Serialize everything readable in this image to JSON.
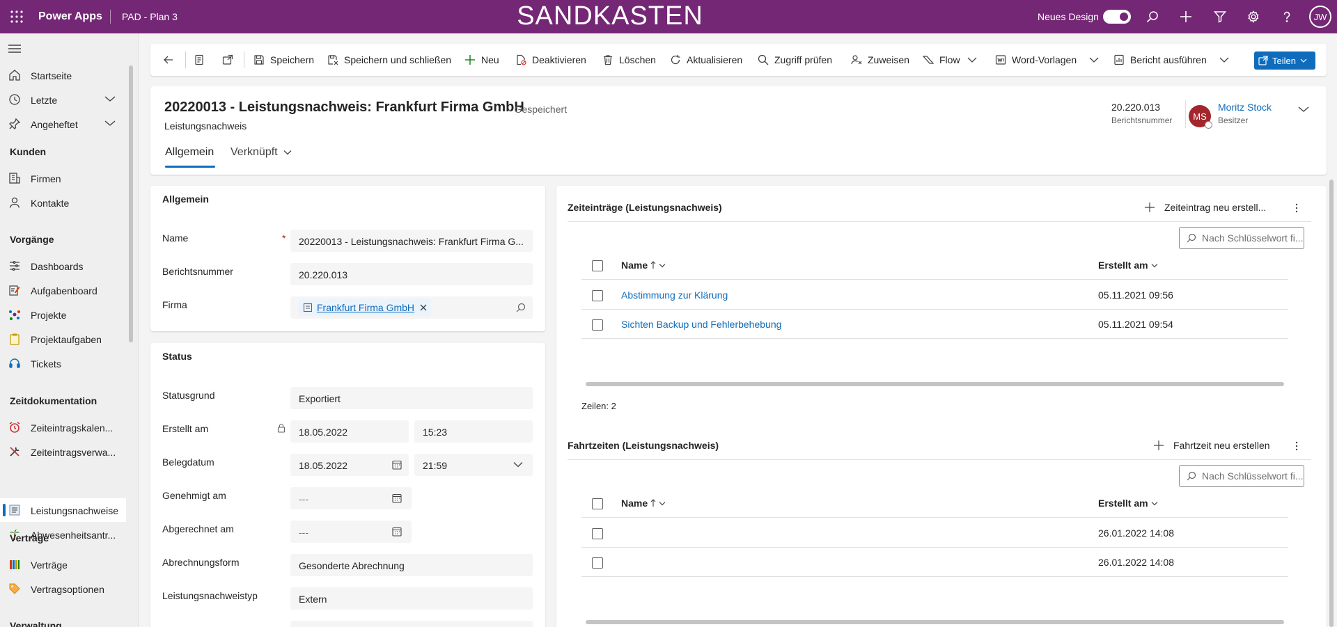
{
  "topbar": {
    "app_name": "Power Apps",
    "app_title": "PAD - Plan 3",
    "environment": "SANDKASTEN",
    "new_design_label": "Neues Design",
    "new_design_on": true,
    "user_initials": "JW",
    "icons": [
      "waffle-icon",
      "search-icon",
      "plus-icon",
      "filter-icon",
      "settings-icon",
      "help-icon"
    ]
  },
  "sidebar": {
    "items_top": [
      {
        "label": "Startseite",
        "icon": "home-icon"
      },
      {
        "label": "Letzte",
        "icon": "clock-icon",
        "expandable": true
      },
      {
        "label": "Angeheftet",
        "icon": "pin-icon",
        "expandable": true
      }
    ],
    "groups": [
      {
        "title": "Kunden",
        "items": [
          {
            "label": "Firmen",
            "icon": "building-icon"
          },
          {
            "label": "Kontakte",
            "icon": "person-icon"
          }
        ]
      },
      {
        "title": "Vorgänge",
        "items": [
          {
            "label": "Dashboards",
            "icon": "dashboard-icon"
          },
          {
            "label": "Aufgabenboard",
            "icon": "taskboard-icon"
          },
          {
            "label": "Projekte",
            "icon": "projects-icon"
          },
          {
            "label": "Projektaufgaben",
            "icon": "clipboard-icon"
          },
          {
            "label": "Tickets",
            "icon": "headset-icon"
          }
        ]
      },
      {
        "title": "Zeitdokumentation",
        "items": [
          {
            "label": "Zeiteintragskalen...",
            "icon": "alarm-icon"
          },
          {
            "label": "Zeiteintragsverwa...",
            "icon": "tools-icon"
          },
          {
            "label": "Leistungsnachweise",
            "icon": "report-icon",
            "active": true
          },
          {
            "label": "Abwesenheitsantr...",
            "icon": "palm-tree-icon"
          }
        ]
      },
      {
        "title": "Verträge",
        "items": [
          {
            "label": "Verträge",
            "icon": "books-icon"
          },
          {
            "label": "Vertragsoptionen",
            "icon": "tag-icon"
          }
        ]
      },
      {
        "title": "Verwaltung",
        "items": []
      }
    ]
  },
  "commandbar": {
    "items": [
      {
        "label": "Speichern",
        "icon": "save-icon"
      },
      {
        "label": "Speichern und schließen",
        "icon": "save-close-icon"
      },
      {
        "label": "Neu",
        "icon": "plus-icon"
      },
      {
        "label": "Deaktivieren",
        "icon": "deactivate-icon"
      },
      {
        "label": "Löschen",
        "icon": "delete-icon"
      },
      {
        "label": "Aktualisieren",
        "icon": "refresh-icon"
      },
      {
        "label": "Zugriff prüfen",
        "icon": "check-access-icon"
      },
      {
        "label": "Zuweisen",
        "icon": "assign-icon"
      },
      {
        "label": "Flow",
        "icon": "flow-icon"
      },
      {
        "label": "Word-Vorlagen",
        "icon": "word-icon"
      },
      {
        "label": "Bericht ausführen",
        "icon": "report-run-icon"
      }
    ],
    "share_label": "Teilen"
  },
  "record": {
    "title": "20220013 - Leistungsnachweis: Frankfurt Firma GmbH",
    "saved_status": "- Gespeichert",
    "entity": "Leistungsnachweis",
    "header_number": "20.220.013",
    "header_number_label": "Berichtsnummer",
    "owner_initials": "MS",
    "owner_name": "Moritz Stock",
    "owner_role": "Besitzer",
    "tabs": [
      {
        "label": "Allgemein",
        "active": true
      },
      {
        "label": "Verknüpft",
        "active": false
      }
    ]
  },
  "section_allgemein": {
    "title": "Allgemein",
    "name_label": "Name",
    "name_value": "20220013 - Leistungsnachweis: Frankfurt Firma G...",
    "number_label": "Berichtsnummer",
    "number_value": "20.220.013",
    "company_label": "Firma",
    "company_value": "Frankfurt Firma GmbH"
  },
  "section_status": {
    "title": "Status",
    "statusgrund_label": "Statusgrund",
    "statusgrund_value": "Exportiert",
    "erstellt_label": "Erstellt am",
    "erstellt_date": "18.05.2022",
    "erstellt_time": "15:23",
    "beleg_label": "Belegdatum",
    "beleg_date": "18.05.2022",
    "beleg_time": "21:59",
    "genehmigt_label": "Genehmigt am",
    "genehmigt_value": "---",
    "abgerechnet_label": "Abgerechnet am",
    "abgerechnet_value": "---",
    "abrechnungsform_label": "Abrechnungsform",
    "abrechnungsform_value": "Gesonderte Abrechnung",
    "typ_label": "Leistungsnachweistyp",
    "typ_value": "Extern"
  },
  "grid_zeit": {
    "title": "Zeiteinträge (Leistungsnachweis)",
    "new_label": "Zeiteintrag neu erstell...",
    "search_placeholder": "Nach Schlüsselwort fi...",
    "col_name": "Name",
    "col_created": "Erstellt am",
    "rows": [
      {
        "name": "Abstimmung zur Klärung",
        "created": "05.11.2021 09:56"
      },
      {
        "name": "Sichten Backup und Fehlerbehebung",
        "created": "05.11.2021 09:54"
      }
    ],
    "row_count": "Zeilen: 2"
  },
  "grid_fahrt": {
    "title": "Fahrtzeiten (Leistungsnachweis)",
    "new_label": "Fahrtzeit neu erstellen",
    "search_placeholder": "Nach Schlüsselwort fi...",
    "col_name": "Name",
    "col_created": "Erstellt am",
    "rows": [
      {
        "name": "",
        "created": "26.01.2022 14:08"
      },
      {
        "name": "",
        "created": "26.01.2022 14:08"
      }
    ]
  },
  "colors": {
    "topbar": "#742774",
    "accent": "#0f6cbd",
    "owner_avatar": "#a4262c"
  }
}
